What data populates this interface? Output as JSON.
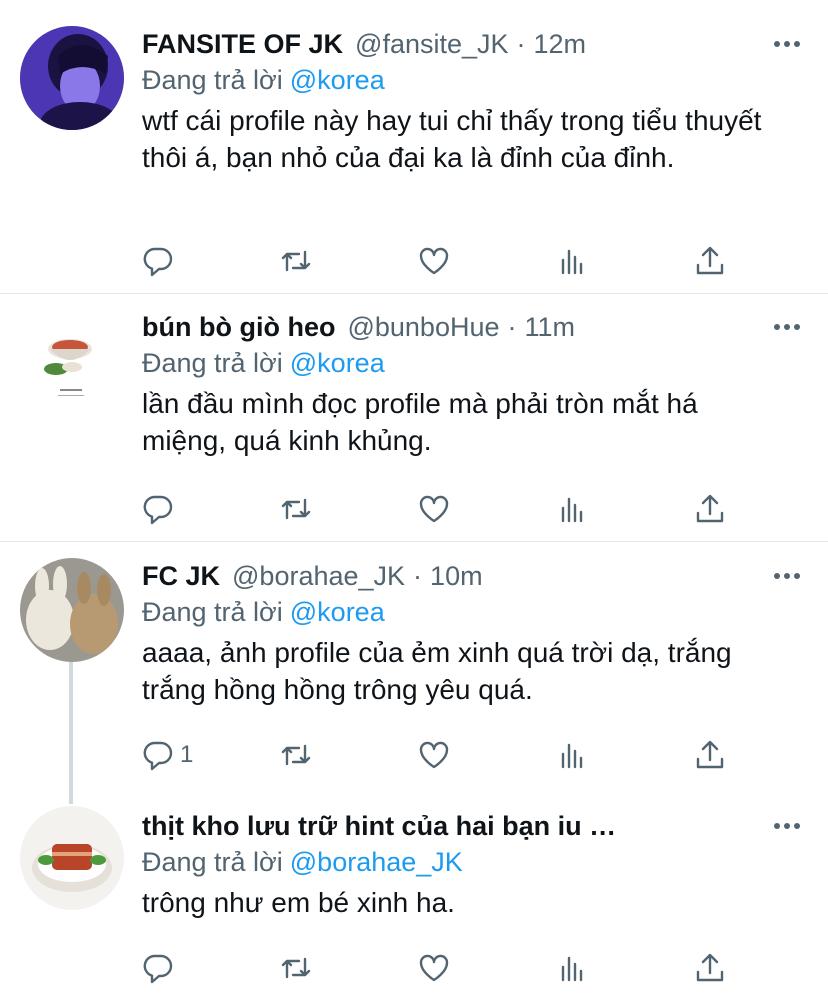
{
  "tweets": [
    {
      "name": "FANSITE OF JK",
      "handle": "@fansite_JK",
      "separator": "·",
      "time": "12m",
      "reply_prefix": "Đang trả lời",
      "reply_to": "@korea",
      "text": "wtf cái profile này hay tui chỉ thấy trong tiểu thuyết thôi á, bạn nhỏ của đại ka là đỉnh của đỉnh.",
      "reply_count": "",
      "avatar_icon": "purple-portrait-avatar"
    },
    {
      "name": "bún bò giò heo",
      "handle": "@bunboHue",
      "separator": "·",
      "time": "11m",
      "reply_prefix": "Đang trả lời",
      "reply_to": "@korea",
      "text": "lần đầu mình đọc profile mà phải tròn mắt há miệng, quá kinh khủng.",
      "reply_count": "",
      "avatar_icon": "noodle-bowl-avatar"
    },
    {
      "name": "FC JK",
      "handle": "@borahae_JK",
      "separator": "·",
      "time": "10m",
      "reply_prefix": "Đang trả lời",
      "reply_to": "@korea",
      "text": "aaaa, ảnh profile của ẻm xinh quá trời dạ, trắng trắng hồng hồng trông yêu quá.",
      "reply_count": "1",
      "avatar_icon": "bunny-plush-avatar"
    },
    {
      "name": "thịt kho lưu trữ hint của hai bạn iu …",
      "handle": "",
      "separator": "",
      "time": "",
      "reply_prefix": "Đang trả lời",
      "reply_to": "@borahae_JK",
      "text": "trông như em bé xinh ha.",
      "reply_count": "",
      "avatar_icon": "braised-pork-avatar"
    }
  ],
  "colors": {
    "text": "#0f1419",
    "secondary": "#536471",
    "link": "#1d9bf0",
    "divider": "#e3e6e8"
  },
  "action_icons": [
    "reply-icon",
    "retweet-icon",
    "like-icon",
    "analytics-icon",
    "share-icon"
  ]
}
